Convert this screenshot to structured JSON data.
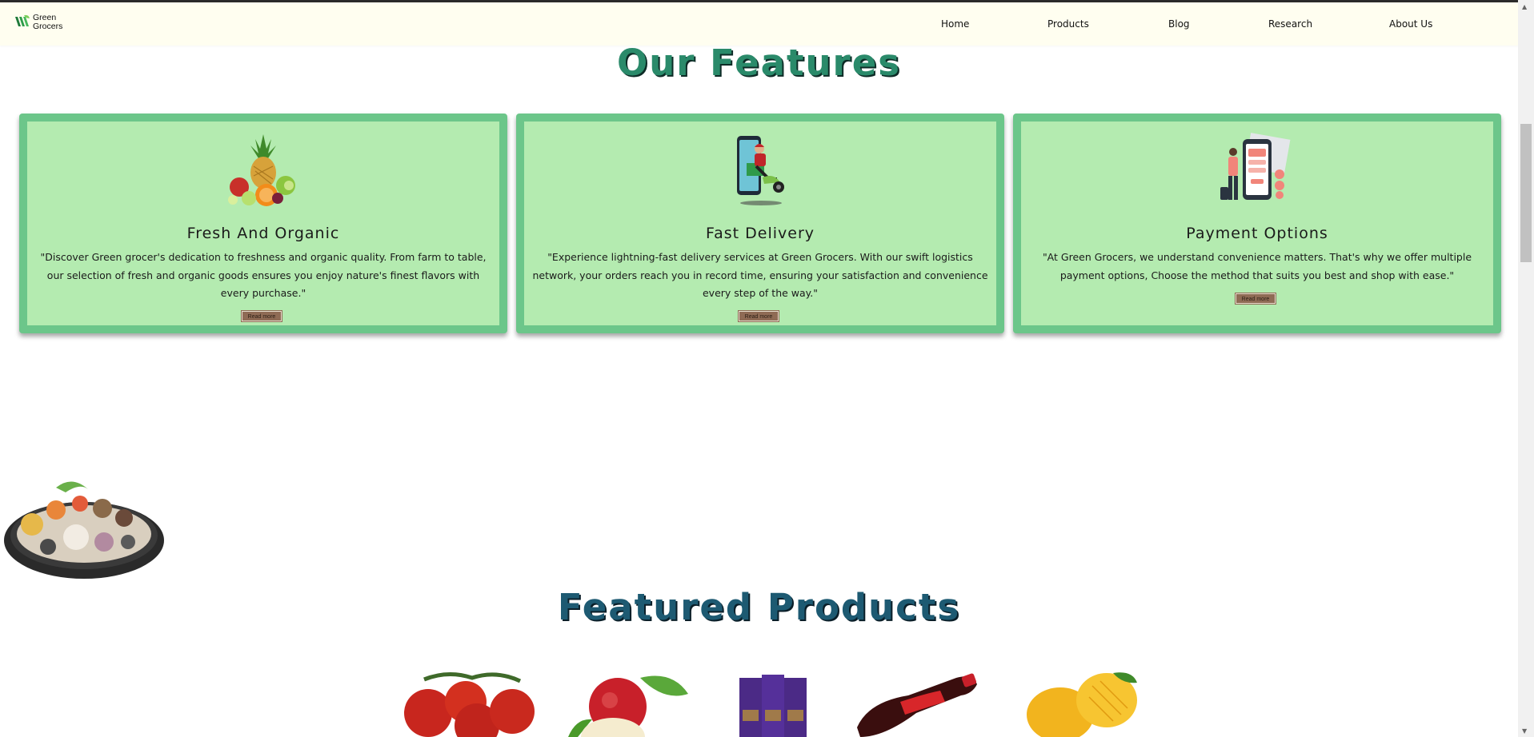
{
  "brand": {
    "line1": "Green",
    "line2": "Grocers"
  },
  "nav": {
    "home": "Home",
    "products": "Products",
    "blog": "Blog",
    "research": "Research",
    "about": "About Us"
  },
  "features": {
    "title": "Our Features",
    "cards": [
      {
        "icon": "fruits-icon",
        "title": "Fresh And Organic",
        "text": "\"Discover Green grocer's dedication to freshness and organic quality. From farm to table, our selection of fresh and organic goods ensures you enjoy nature's finest flavors with every purchase.\"",
        "button": "Read more"
      },
      {
        "icon": "delivery-scooter-icon",
        "title": "Fast Delivery",
        "text": "\"Experience lightning-fast delivery services at Green Grocers. With our swift logistics network, your orders reach you in record time, ensuring your satisfaction and convenience every step of the way.\"",
        "button": "Read more"
      },
      {
        "icon": "mobile-payment-icon",
        "title": "Payment Options",
        "text": "\"At Green Grocers, we understand convenience matters. That's why we offer multiple payment options, Choose the method that suits you best and shop with ease.\"",
        "button": "Read more"
      }
    ]
  },
  "featured_products": {
    "title": "Featured Products",
    "items": [
      "tomatoes-image",
      "apples-image",
      "chocolate-bars-image",
      "cola-bottle-image",
      "mangoes-image"
    ]
  },
  "colors": {
    "card_bg": "#b4ebb0",
    "card_border": "#6cc68a",
    "features_title": "#2a8a6a",
    "products_title": "#1d5a72",
    "navbar_bg": "#fffef0"
  }
}
